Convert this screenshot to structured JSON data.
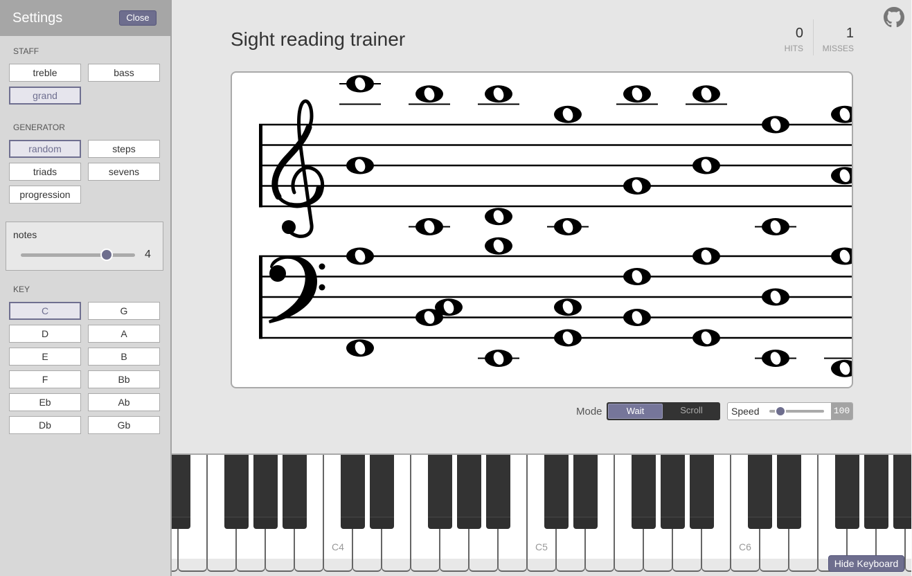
{
  "sidebar": {
    "title": "Settings",
    "close_label": "Close",
    "staff": {
      "label": "STAFF",
      "options": [
        {
          "label": "treble",
          "selected": false
        },
        {
          "label": "bass",
          "selected": false
        },
        {
          "label": "grand",
          "selected": true
        }
      ]
    },
    "generator": {
      "label": "GENERATOR",
      "options": [
        {
          "label": "random",
          "selected": true
        },
        {
          "label": "steps",
          "selected": false
        },
        {
          "label": "triads",
          "selected": false
        },
        {
          "label": "sevens",
          "selected": false
        },
        {
          "label": "progression",
          "selected": false
        }
      ]
    },
    "notes": {
      "label": "notes",
      "value": "4",
      "position": 0.75
    },
    "key": {
      "label": "KEY",
      "options": [
        {
          "label": "C",
          "selected": true
        },
        {
          "label": "G",
          "selected": false
        },
        {
          "label": "D",
          "selected": false
        },
        {
          "label": "A",
          "selected": false
        },
        {
          "label": "E",
          "selected": false
        },
        {
          "label": "B",
          "selected": false
        },
        {
          "label": "F",
          "selected": false
        },
        {
          "label": "Bb",
          "selected": false
        },
        {
          "label": "Eb",
          "selected": false
        },
        {
          "label": "Ab",
          "selected": false
        },
        {
          "label": "Db",
          "selected": false
        },
        {
          "label": "Gb",
          "selected": false
        }
      ]
    }
  },
  "header": {
    "title": "Sight reading trainer",
    "stats": [
      {
        "value": "0",
        "label": "HITS"
      },
      {
        "value": "1",
        "label": "MISSES"
      }
    ],
    "github_icon": "github-icon"
  },
  "staff": {
    "type": "grand",
    "clefs": [
      "treble",
      "bass"
    ],
    "chords": [
      {
        "treble": [
          "C6",
          "B4"
        ],
        "bass": [
          "A3",
          "F2"
        ]
      },
      {
        "treble": [
          "B5",
          "C4"
        ],
        "bass": [
          "C3",
          "B2"
        ]
      },
      {
        "treble": [
          "B5",
          "D4"
        ],
        "bass": [
          "B3",
          "E2"
        ]
      },
      {
        "treble": [
          "G5",
          "C4"
        ],
        "bass": [
          "C3",
          "G2"
        ]
      },
      {
        "treble": [
          "B5",
          "G4"
        ],
        "bass": [
          "F3",
          "B2"
        ]
      },
      {
        "treble": [
          "B5",
          "B4"
        ],
        "bass": [
          "A3",
          "G2"
        ]
      },
      {
        "treble": [
          "F5",
          "C4"
        ],
        "bass": [
          "D3",
          "E2"
        ]
      },
      {
        "treble": [
          "G5",
          "A4"
        ],
        "bass": [
          "A3",
          "D2"
        ]
      }
    ]
  },
  "controls": {
    "mode_label": "Mode",
    "modes": [
      {
        "label": "Wait",
        "active": true
      },
      {
        "label": "Scroll",
        "active": false
      }
    ],
    "speed": {
      "label": "Speed",
      "value": "100",
      "position": 0.2
    }
  },
  "keyboard": {
    "white_keys": [
      "D3",
      "E3",
      "F3",
      "G3",
      "A3",
      "B3",
      "C4",
      "D4",
      "E4",
      "F4",
      "G4",
      "A4",
      "B4",
      "C5",
      "D5",
      "E5",
      "F5",
      "G5",
      "A5",
      "B5",
      "C6",
      "D6",
      "E6",
      "F6",
      "G6",
      "A6",
      "B6"
    ],
    "labeled_keys": [
      "C4",
      "C5",
      "C6"
    ],
    "hide_label": "Hide Keyboard"
  },
  "colors": {
    "accent": "#6e6e8e",
    "sidebar_bg": "#d8d8d8",
    "sidebar_header_bg": "#a6a6a6",
    "main_bg": "#e6e6e6",
    "black_key": "#333333",
    "mode_toggle_bg": "#333333"
  }
}
